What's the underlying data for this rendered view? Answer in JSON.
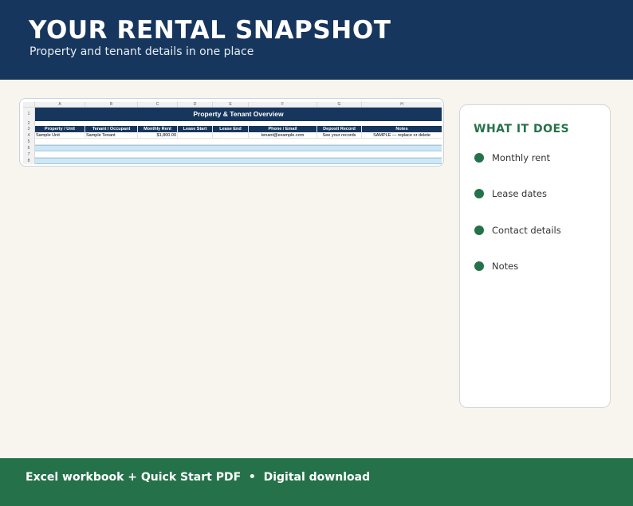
{
  "header": {
    "title": "YOUR RENTAL SNAPSHOT",
    "subtitle": "Property and tenant details in one place"
  },
  "spreadsheet": {
    "column_letters": [
      "A",
      "B",
      "C",
      "D",
      "E",
      "F",
      "G",
      "H"
    ],
    "row_numbers": [
      "1",
      "2",
      "3",
      "4",
      "5",
      "6",
      "7",
      "8"
    ],
    "banner_title": "Property & Tenant Overview",
    "headers": [
      "Property / Unit",
      "Tenant / Occupant",
      "Monthly Rent",
      "Lease Start",
      "Lease End",
      "Phone / Email",
      "Deposit Record",
      "Notes"
    ],
    "sample_row": [
      "Sample Unit",
      "Sample Tenant",
      "$1,800.00",
      "",
      "",
      "tenant@example.com",
      "See your records",
      "SAMPLE — replace or delete"
    ],
    "colors": {
      "header_fill": "#17365d",
      "band_fill": "#cfe7f5",
      "band_border": "#9ecbe6"
    }
  },
  "panel": {
    "title": "WHAT IT DOES",
    "features": [
      "Monthly rent",
      "Lease dates",
      "Contact details",
      "Notes"
    ],
    "accent_color": "#25724a"
  },
  "footer": {
    "text": "Excel workbook + Quick Start PDF  •  Digital download",
    "background": "#25724a"
  }
}
